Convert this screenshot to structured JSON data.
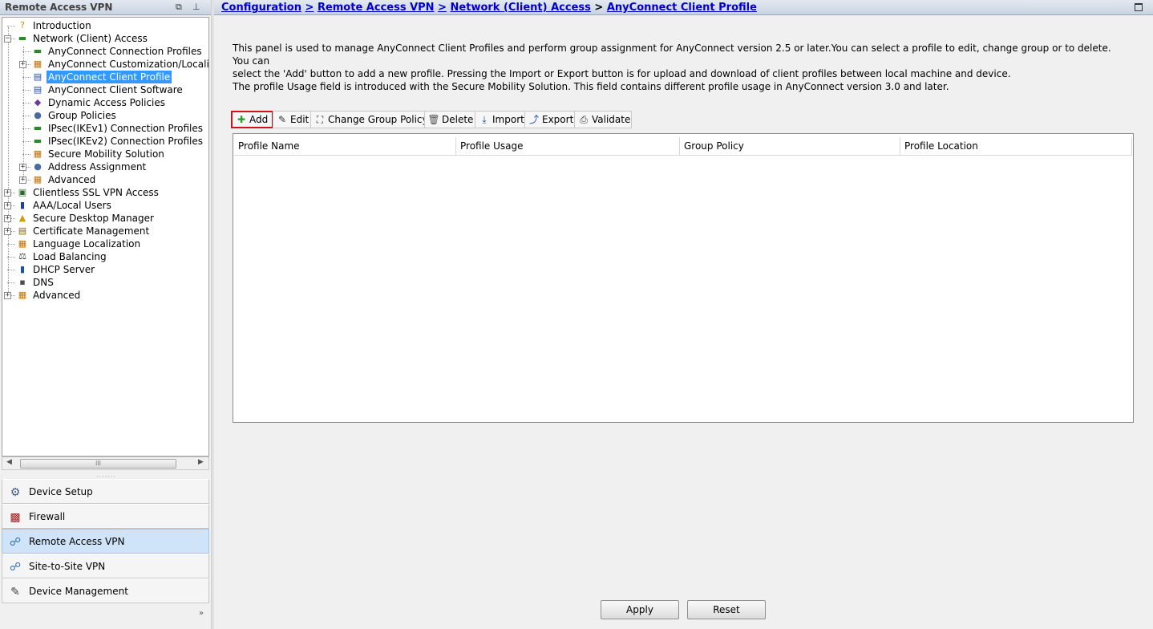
{
  "left_panel": {
    "title": "Remote Access VPN",
    "restore_icon": "restore-icon",
    "pin_icon": "pin-icon"
  },
  "tree": [
    {
      "name": "tree-item-introduction",
      "label": "Introduction",
      "level": 1,
      "icon": "help-icon",
      "glyph": "?",
      "color": "#c89000",
      "expander": ""
    },
    {
      "name": "tree-item-network-client-access",
      "label": "Network (Client) Access",
      "level": 1,
      "icon": "network-access-icon",
      "glyph": "▬",
      "color": "#2a8a2a",
      "expander": "−"
    },
    {
      "name": "tree-item-anyconnect-connection-profiles",
      "label": "AnyConnect Connection Profiles",
      "level": 2,
      "icon": "connection-profile-icon",
      "glyph": "▬",
      "color": "#2a8a2a",
      "expander": ""
    },
    {
      "name": "tree-item-anyconnect-customization",
      "label": "AnyConnect Customization/Localiza",
      "level": 2,
      "icon": "customization-icon",
      "glyph": "▦",
      "color": "#c07000",
      "expander": "+"
    },
    {
      "name": "tree-item-anyconnect-client-profile",
      "label": "AnyConnect Client Profile",
      "level": 2,
      "icon": "client-profile-icon",
      "glyph": "▤",
      "color": "#2050a0",
      "expander": "",
      "selected": true
    },
    {
      "name": "tree-item-anyconnect-client-software",
      "label": "AnyConnect Client Software",
      "level": 2,
      "icon": "client-software-icon",
      "glyph": "▤",
      "color": "#2050a0",
      "expander": ""
    },
    {
      "name": "tree-item-dynamic-access-policies",
      "label": "Dynamic Access Policies",
      "level": 2,
      "icon": "dynamic-access-icon",
      "glyph": "◆",
      "color": "#6a3aa0",
      "expander": ""
    },
    {
      "name": "tree-item-group-policies",
      "label": "Group Policies",
      "level": 2,
      "icon": "group-policy-icon",
      "glyph": "●",
      "color": "#4a6aa0",
      "expander": ""
    },
    {
      "name": "tree-item-ipsec-ikev1",
      "label": "IPsec(IKEv1) Connection Profiles",
      "level": 2,
      "icon": "ipsec-profile-icon",
      "glyph": "▬",
      "color": "#2a8a2a",
      "expander": ""
    },
    {
      "name": "tree-item-ipsec-ikev2",
      "label": "IPsec(IKEv2) Connection Profiles",
      "level": 2,
      "icon": "ipsec-profile-icon",
      "glyph": "▬",
      "color": "#2a8a2a",
      "expander": ""
    },
    {
      "name": "tree-item-secure-mobility-solution",
      "label": "Secure Mobility Solution",
      "level": 2,
      "icon": "mobility-icon",
      "glyph": "▦",
      "color": "#c07000",
      "expander": ""
    },
    {
      "name": "tree-item-address-assignment",
      "label": "Address Assignment",
      "level": 2,
      "icon": "address-assignment-icon",
      "glyph": "●",
      "color": "#4a6aa0",
      "expander": "+"
    },
    {
      "name": "tree-item-advanced-network",
      "label": "Advanced",
      "level": 2,
      "icon": "advanced-icon",
      "glyph": "▦",
      "color": "#c07000",
      "expander": "+"
    },
    {
      "name": "tree-item-clientless-ssl-vpn",
      "label": "Clientless SSL VPN Access",
      "level": 1,
      "icon": "clientless-vpn-icon",
      "glyph": "▣",
      "color": "#2a6a2a",
      "expander": "+"
    },
    {
      "name": "tree-item-aaa-local-users",
      "label": "AAA/Local Users",
      "level": 1,
      "icon": "aaa-users-icon",
      "glyph": "▮",
      "color": "#2040a0",
      "expander": "+"
    },
    {
      "name": "tree-item-secure-desktop-manager",
      "label": "Secure Desktop Manager",
      "level": 1,
      "icon": "secure-desktop-icon",
      "glyph": "▲",
      "color": "#d0a000",
      "expander": "+"
    },
    {
      "name": "tree-item-certificate-management",
      "label": "Certificate Management",
      "level": 1,
      "icon": "certificate-icon",
      "glyph": "▤",
      "color": "#806020",
      "expander": "+"
    },
    {
      "name": "tree-item-language-localization",
      "label": "Language Localization",
      "level": 1,
      "icon": "language-icon",
      "glyph": "▦",
      "color": "#c07000",
      "expander": ""
    },
    {
      "name": "tree-item-load-balancing",
      "label": "Load Balancing",
      "level": 1,
      "icon": "load-balancing-icon",
      "glyph": "⚖",
      "color": "#333333",
      "expander": ""
    },
    {
      "name": "tree-item-dhcp-server",
      "label": "DHCP Server",
      "level": 1,
      "icon": "dhcp-server-icon",
      "glyph": "▮",
      "color": "#2050a0",
      "expander": ""
    },
    {
      "name": "tree-item-dns",
      "label": "DNS",
      "level": 1,
      "icon": "dns-icon",
      "glyph": "▪",
      "color": "#505050",
      "expander": ""
    },
    {
      "name": "tree-item-advanced",
      "label": "Advanced",
      "level": 1,
      "icon": "advanced-icon",
      "glyph": "▦",
      "color": "#c07000",
      "expander": "+"
    }
  ],
  "scrollbar": {
    "grip": "III"
  },
  "nav_buttons": [
    {
      "name": "nav-device-setup",
      "label": "Device Setup",
      "icon": "device-setup-icon",
      "glyph": "⚙",
      "color": "#405a80",
      "active": false
    },
    {
      "name": "nav-firewall",
      "label": "Firewall",
      "icon": "firewall-icon",
      "glyph": "▩",
      "color": "#a02020",
      "active": false
    },
    {
      "name": "nav-remote-access-vpn",
      "label": "Remote Access VPN",
      "icon": "remote-access-vpn-icon",
      "glyph": "☍",
      "color": "#2a70b0",
      "active": true
    },
    {
      "name": "nav-site-to-site-vpn",
      "label": "Site-to-Site VPN",
      "icon": "site-to-site-vpn-icon",
      "glyph": "☍",
      "color": "#2a70b0",
      "active": false
    },
    {
      "name": "nav-device-management",
      "label": "Device Management",
      "icon": "device-management-icon",
      "glyph": "✎",
      "color": "#404040",
      "active": false
    }
  ],
  "nav_more": "»",
  "breadcrumb": {
    "items": [
      "Configuration",
      "Remote Access VPN",
      "Network (Client) Access",
      "AnyConnect Client Profile"
    ],
    "separator": ">"
  },
  "description": [
    "This panel is used to manage AnyConnect Client Profiles and perform group assignment for AnyConnect version 2.5 or later.You can select a profile to edit, change group or to delete. You can",
    "select the 'Add' button to add a new profile. Pressing the Import or Export button is for upload and download of client profiles between local machine and device.",
    "The profile Usage field is introduced with the Secure Mobility Solution. This field contains different profile usage in AnyConnect version 3.0 and later."
  ],
  "toolbar": [
    {
      "name": "add-button",
      "label": "Add",
      "icon": "add-icon",
      "glyph": "✚",
      "color": "#2a9a2a",
      "highlight": true
    },
    {
      "name": "edit-button",
      "label": "Edit",
      "icon": "edit-icon",
      "glyph": "✎",
      "color": "#333333"
    },
    {
      "name": "change-group-policy-button",
      "label": "Change Group Policy",
      "icon": "change-group-policy-icon",
      "glyph": "⛶",
      "color": "#333333"
    },
    {
      "name": "delete-button",
      "label": "Delete",
      "icon": "delete-icon",
      "glyph": "🗑",
      "color": "#555555"
    },
    {
      "name": "import-button",
      "label": "Import",
      "icon": "import-icon",
      "glyph": "⤓",
      "color": "#2050a0"
    },
    {
      "name": "export-button",
      "label": "Export",
      "icon": "export-icon",
      "glyph": "⤴",
      "color": "#2050a0"
    },
    {
      "name": "validate-button",
      "label": "Validate",
      "icon": "validate-icon",
      "glyph": "⎙",
      "color": "#333333"
    }
  ],
  "table": {
    "columns": [
      "Profile Name",
      "Profile Usage",
      "Group Policy",
      "Profile Location"
    ],
    "rows": []
  },
  "footer": {
    "apply": "Apply",
    "reset": "Reset"
  },
  "colors": {
    "link": "#0000cc",
    "selection": "#3399ff",
    "highlight_border": "#d0121b",
    "active_nav": "#cfe4f8"
  }
}
